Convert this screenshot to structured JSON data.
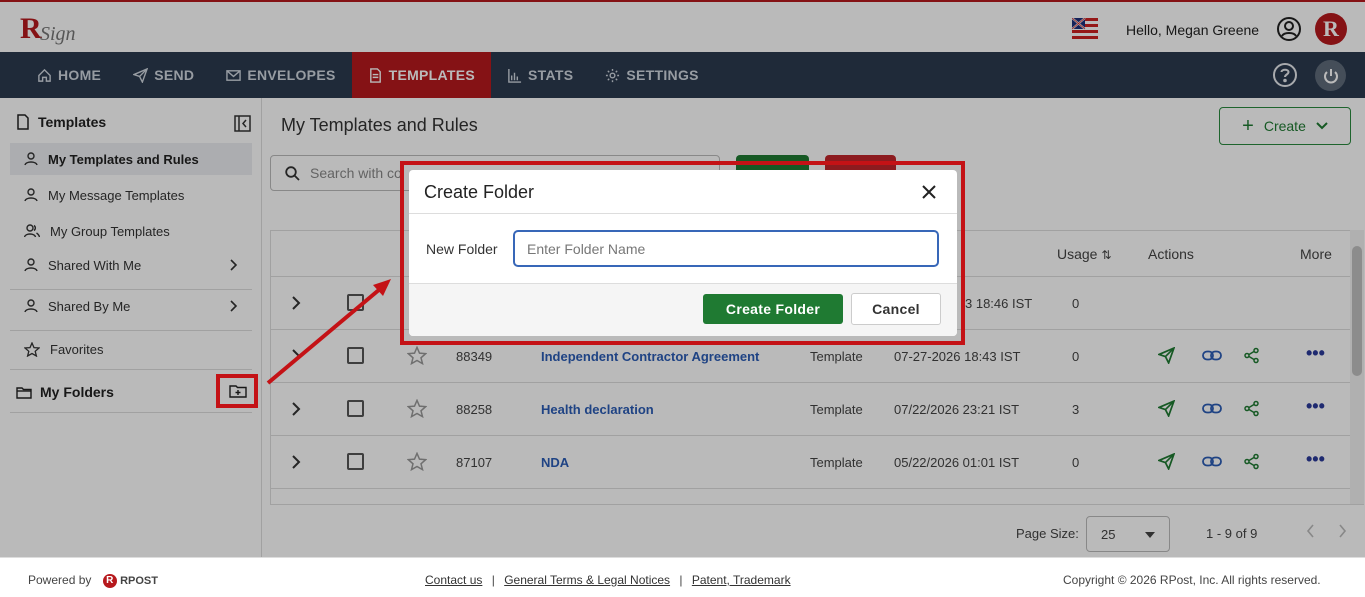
{
  "header": {
    "logo_text": "RSign",
    "greeting": "Hello, Megan Greene",
    "avatar_letter": "R"
  },
  "nav": {
    "items": [
      {
        "label": "HOME",
        "icon": "home-icon"
      },
      {
        "label": "SEND",
        "icon": "send-icon"
      },
      {
        "label": "ENVELOPES",
        "icon": "envelope-icon"
      },
      {
        "label": "TEMPLATES",
        "icon": "document-icon",
        "active": true
      },
      {
        "label": "STATS",
        "icon": "bar-chart-icon"
      },
      {
        "label": "SETTINGS",
        "icon": "gear-icon"
      }
    ]
  },
  "sidebar": {
    "title": "Templates",
    "items": [
      {
        "label": "My Templates and Rules",
        "active": true
      },
      {
        "label": "My Message Templates"
      },
      {
        "label": "My Group Templates"
      },
      {
        "label": "Shared With Me",
        "has_chevron": true
      },
      {
        "label": "Shared By Me",
        "has_chevron": true
      },
      {
        "label": "Favorites"
      }
    ],
    "folders_label": "My Folders"
  },
  "main": {
    "title": "My Templates and Rules",
    "create_label": "Create",
    "search_placeholder": "Search with co",
    "columns": {
      "usage": "Usage",
      "actions": "Actions",
      "more": "More"
    },
    "rows": [
      {
        "id": "",
        "name": "",
        "type": "",
        "date": "3 18:46 IST",
        "usage": "0"
      },
      {
        "id": "88349",
        "name": "Independent Contractor Agreement",
        "type": "Template",
        "date": "07-27-2026 18:43 IST",
        "usage": "0"
      },
      {
        "id": "88258",
        "name": "Health declaration",
        "type": "Template",
        "date": "07/22/2026 23:21 IST",
        "usage": "3"
      },
      {
        "id": "87107",
        "name": "NDA",
        "type": "Template",
        "date": "05/22/2026 01:01 IST",
        "usage": "0"
      }
    ],
    "pager": {
      "page_size_label": "Page Size:",
      "page_size": "25",
      "range": "1 - 9 of 9"
    }
  },
  "modal": {
    "title": "Create Folder",
    "field_label": "New Folder",
    "field_placeholder": "Enter Folder Name",
    "field_value": "",
    "primary_label": "Create Folder",
    "cancel_label": "Cancel"
  },
  "footer": {
    "powered_by": "Powered by",
    "brand": "RPOST",
    "links": [
      "Contact us",
      "General Terms & Legal Notices",
      "Patent, Trademark"
    ],
    "copyright": "Copyright © 2026 RPost, Inc. All rights reserved."
  },
  "colors": {
    "brand_red": "#b7191d",
    "nav_bg": "#2b3a4f",
    "green": "#1f7a32",
    "link_blue": "#2b5db5",
    "highlight_red": "#c41216"
  }
}
